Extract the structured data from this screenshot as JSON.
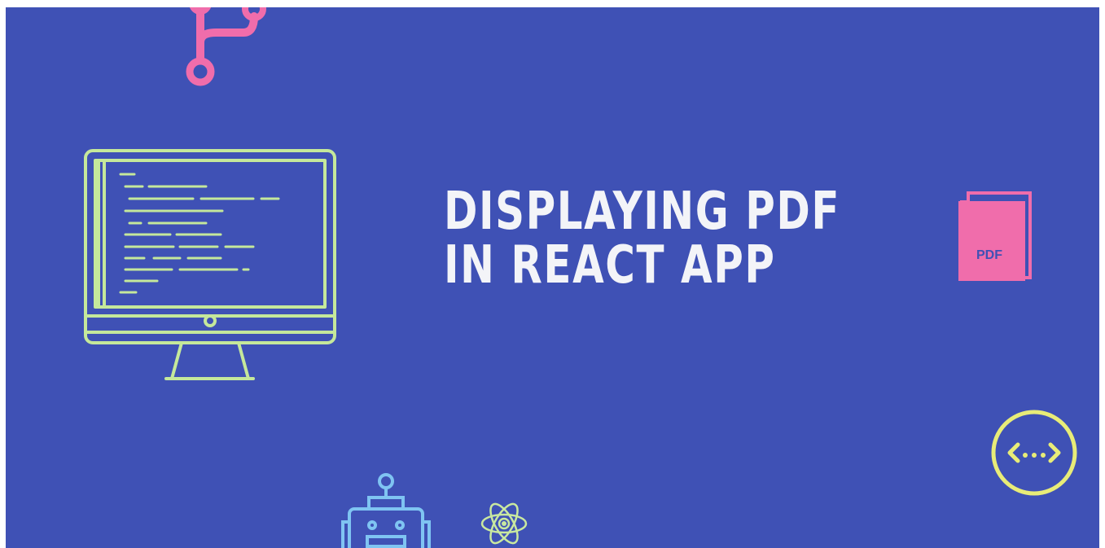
{
  "headline": {
    "line1": "DISPLAYING PDF",
    "line2": "IN REACT APP"
  },
  "pdf_icon": {
    "label": "PDF"
  },
  "icons": [
    "git-branch-icon",
    "monitor-icon",
    "pdf-file-icon",
    "code-circle-icon",
    "robot-icon",
    "atom-icon"
  ],
  "colors": {
    "background": "#3f51b5",
    "title": "#f3f4f8",
    "monitor": "#c5e89b",
    "git": "#f06dab",
    "pdf": "#f06dab",
    "code_circle": "#e8ec78",
    "robot": "#7fc4f2",
    "atom": "#c9e8a0"
  }
}
